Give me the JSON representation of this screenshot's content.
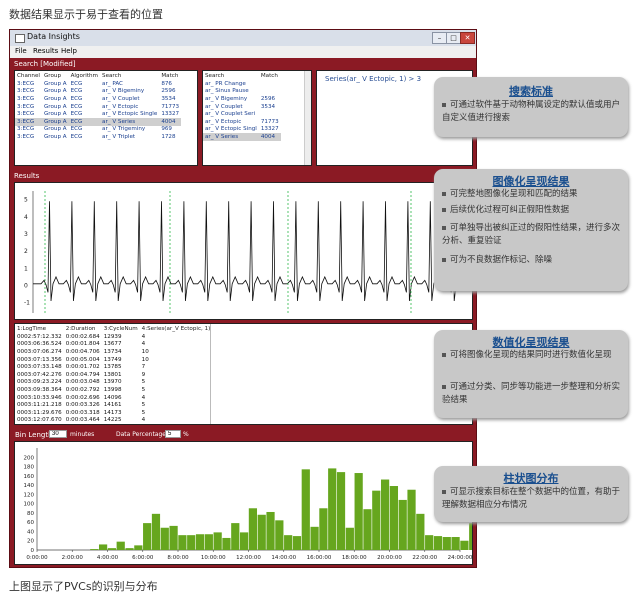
{
  "page": {
    "top_caption": "数据结果显示于易于查看的位置",
    "bottom_caption": "上图显示了PVCs的识别与分布"
  },
  "window": {
    "title": "Data Insights",
    "menu": [
      "File",
      "Results",
      "Help"
    ]
  },
  "search_panel": {
    "title": "Search [Modified]",
    "left_table": {
      "columns": [
        "Channel",
        "Group",
        "Algorithm",
        "Search",
        "Match"
      ],
      "rows": [
        [
          "3:ECG",
          "Group A",
          "ECG",
          "ar_ PAC",
          "876"
        ],
        [
          "3:ECG",
          "Group A",
          "ECG",
          "ar_ V Bigeminy",
          "2596"
        ],
        [
          "3:ECG",
          "Group A",
          "ECG",
          "ar_ V Couplet",
          "3534"
        ],
        [
          "3:ECG",
          "Group A",
          "ECG",
          "ar_ V Ectopic",
          "71773"
        ],
        [
          "3:ECG",
          "Group A",
          "ECG",
          "ar_ V Ectopic Single",
          "13327"
        ],
        [
          "3:ECG",
          "Group A",
          "ECG",
          "ar_ V Series",
          "4004"
        ],
        [
          "3:ECG",
          "Group A",
          "ECG",
          "ar_ V Trigeminy",
          "969"
        ],
        [
          "3:ECG",
          "Group A",
          "ECG",
          "ar_ V Triplet",
          "1728"
        ]
      ],
      "selected_row": 5
    },
    "mid_table": {
      "columns": [
        "Search",
        "Match"
      ],
      "rows": [
        [
          "ar_ PR Change",
          ""
        ],
        [
          "ar_ Sinus Pause",
          ""
        ],
        [
          "ar_ V Bigeminy",
          "2596"
        ],
        [
          "ar_ V Couplet",
          "3534"
        ],
        [
          "ar_ V Couplet Seri",
          ""
        ],
        [
          "ar_ V Ectopic",
          "71773"
        ],
        [
          "ar_ V Ectopic Singl",
          "13327"
        ],
        [
          "ar_ V Series",
          "4004"
        ]
      ],
      "selected_row": 7
    },
    "series_label": "Series(ar_ V Ectopic, 1)  >  3"
  },
  "results_panel": {
    "title": "Results",
    "y_ticks": [
      "5",
      "4",
      "3",
      "2",
      "1",
      "0",
      "-1"
    ]
  },
  "log_table": {
    "columns": [
      "1:LogTime",
      "2:Duration",
      "3:CycleNum",
      "4:Series(ar_V Ectopic, 1)"
    ],
    "rows": [
      [
        "0002:57:12.332",
        "0:00:02.684",
        "12939",
        "4"
      ],
      [
        "0003:06:36.524",
        "0:00:01.804",
        "13677",
        "4"
      ],
      [
        "0003:07:06.274",
        "0:00:04.706",
        "13734",
        "10"
      ],
      [
        "0003:07:13.356",
        "0:00:05.004",
        "13749",
        "10"
      ],
      [
        "0003:07:33.148",
        "0:00:01.702",
        "13785",
        "7"
      ],
      [
        "0003:07:42.276",
        "0:00:04.794",
        "13801",
        "9"
      ],
      [
        "0003:09:23.224",
        "0:00:03.048",
        "13970",
        "5"
      ],
      [
        "0003:09:38.364",
        "0:00:02.792",
        "13998",
        "5"
      ],
      [
        "0003:10:33.946",
        "0:00:02.696",
        "14096",
        "4"
      ],
      [
        "0003:11:21.218",
        "0:00:03.326",
        "14161",
        "5"
      ],
      [
        "0003:11:29.676",
        "0:00:03.318",
        "14173",
        "5"
      ],
      [
        "0003:12:07.670",
        "0:00:03.464",
        "14225",
        "4"
      ]
    ]
  },
  "histogram_panel": {
    "bin_length_label": "Bin Length",
    "bin_length_value": "30",
    "bin_length_unit": "minutes",
    "pct_label": "Data Percentage",
    "pct_value": "5",
    "pct_unit": "%"
  },
  "chart_data": {
    "type": "bar",
    "xlabel": "",
    "ylabel": "",
    "ylim": [
      0,
      220
    ],
    "y_ticks": [
      0,
      20,
      40,
      60,
      80,
      100,
      120,
      140,
      160,
      180,
      200
    ],
    "x_tick_labels": [
      "0:00:00",
      "2:00:00",
      "4:00:00",
      "6:00:00",
      "8:00:00",
      "10:00:00",
      "12:00:00",
      "14:00:00",
      "16:00:00",
      "18:00:00",
      "20:00:00",
      "22:00:00",
      "24:00:00"
    ],
    "bin_hours": 0.5,
    "start_hour": 3,
    "values": [
      2,
      12,
      4,
      18,
      4,
      10,
      58,
      78,
      48,
      52,
      32,
      32,
      34,
      34,
      38,
      26,
      58,
      38,
      90,
      76,
      82,
      64,
      32,
      30,
      174,
      50,
      90,
      176,
      168,
      48,
      166,
      88,
      128,
      152,
      138,
      108,
      130,
      78,
      32,
      30,
      28,
      28,
      20,
      58,
      38
    ],
    "grid": false,
    "legend": "none"
  },
  "callouts": [
    {
      "title": "搜索标准",
      "bullets": [
        "可通过软件基于动物种属设定的默认值或用户自定义值进行搜索"
      ]
    },
    {
      "title": "图像化呈现结果",
      "bullets": [
        "可完整地图像化呈现和匹配的结果",
        "后续优化过程可纠正假阳性数据",
        "可单独导出被纠正过的假阳性结果，进行多次分析、重复验证",
        "可为不良数据作标记、除噪"
      ]
    },
    {
      "title": "数值化呈现结果",
      "bullets": [
        "可将图像化呈现的结果同时进行数值化呈现",
        "可通过分类、同步等功能进一步整理和分析实验结果"
      ]
    },
    {
      "title": "柱状图分布",
      "bullets": [
        "可显示搜索目标在整个数据中的位置，有助于理解数据相应分布情况"
      ]
    }
  ],
  "colors": {
    "window_frame": "#8b1a24",
    "histogram_bar": "#66a61e",
    "callout_bg": "#c8c8c8",
    "callout_title": "#1a4f8f"
  }
}
